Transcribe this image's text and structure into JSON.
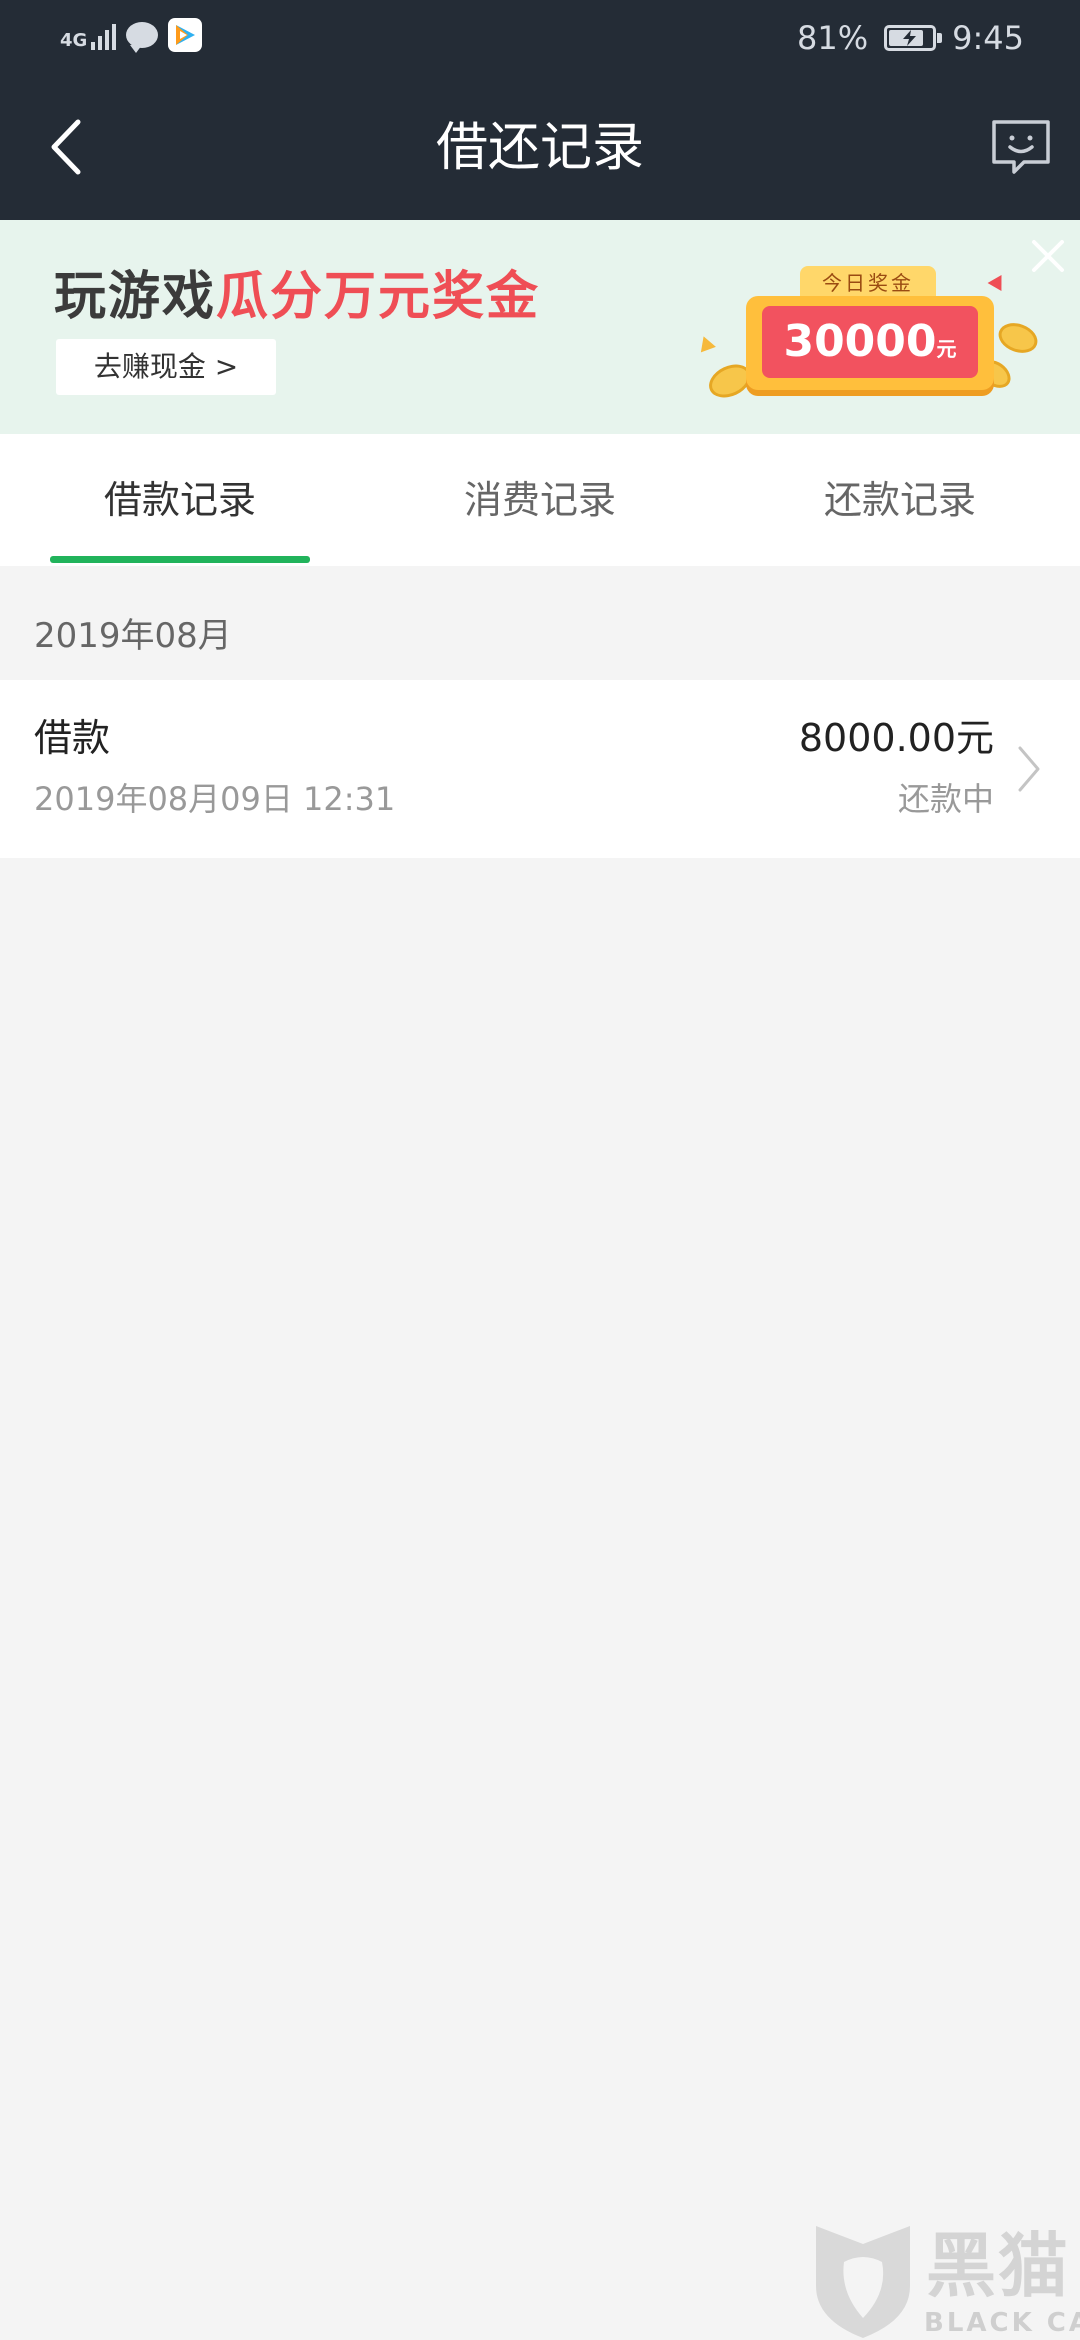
{
  "status_bar": {
    "network_label": "4G",
    "battery_percent_text": "81%",
    "battery_level": 0.81,
    "time": "9:45",
    "icons": [
      "signal-icon",
      "message-bubble-icon",
      "tencent-video-icon",
      "battery-charging-icon"
    ]
  },
  "nav": {
    "title": "借还记录",
    "back_icon": "chevron-left-icon",
    "feedback_icon": "chat-feedback-icon"
  },
  "banner": {
    "title_part1": "玩游戏",
    "title_part2": "瓜分万元奖金",
    "button_label": "去赚现金 >",
    "prize_tab": "今日奖金",
    "prize_amount": "30000",
    "prize_unit": "元",
    "close_icon": "close-icon",
    "colors": {
      "background": "#e7f4ed",
      "highlight": "#ef4e55"
    }
  },
  "tabs": [
    {
      "label": "借款记录",
      "active": true
    },
    {
      "label": "消费记录",
      "active": false
    },
    {
      "label": "还款记录",
      "active": false
    }
  ],
  "accent_color": "#21b35b",
  "records_section": {
    "month": "2019年08月",
    "items": [
      {
        "type": "借款",
        "datetime": "2019年08月09日 12:31",
        "amount": "8000.00元",
        "status": "还款中"
      }
    ]
  },
  "watermark": {
    "title": "黑猫",
    "subtitle": "BLACK CAT"
  }
}
